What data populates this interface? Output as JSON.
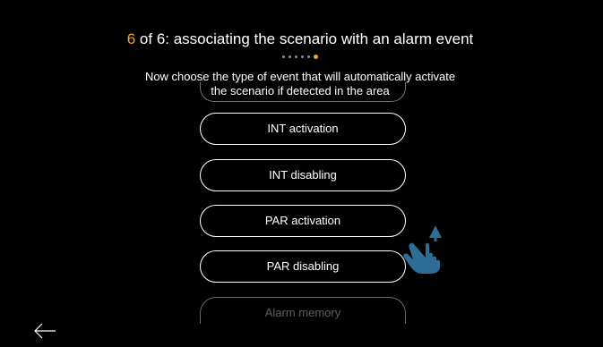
{
  "header": {
    "step_number": "6",
    "title_rest": " of 6: associating the scenario with an alarm event"
  },
  "progress": {
    "total_steps": 6,
    "current_step": 6
  },
  "instruction": {
    "line1": "Now choose the type of event that will automatically activate",
    "line2": "the scenario if detected in the area"
  },
  "options": [
    {
      "label": "INT activation"
    },
    {
      "label": "INT disabling"
    },
    {
      "label": "PAR activation"
    },
    {
      "label": "PAR disabling"
    },
    {
      "label": "Alarm memory"
    }
  ],
  "colors": {
    "accent": "#f5a623",
    "background": "#000000",
    "text": "#ffffff",
    "hand_icon": "#2e6e96"
  },
  "icons": {
    "back": "left-arrow-icon",
    "hint": "swipe-up-hand-icon"
  }
}
